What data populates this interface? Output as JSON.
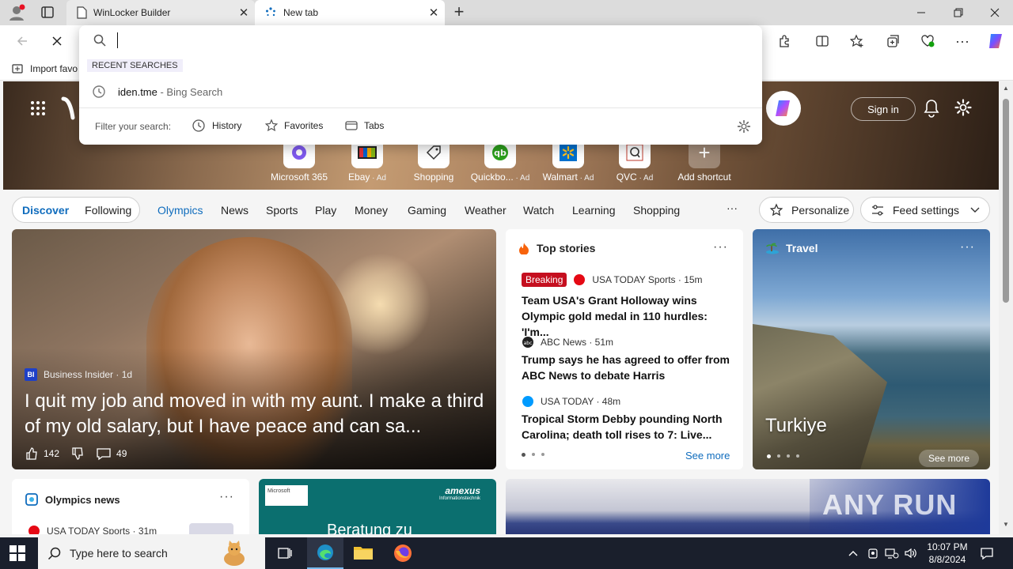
{
  "tabs": [
    {
      "title": "WinLocker Builder"
    },
    {
      "title": "New tab"
    }
  ],
  "favorites_bar": {
    "import_label": "Import favo"
  },
  "omnibox": {
    "recent_heading": "RECENT SEARCHES",
    "recent_item": {
      "query": "iden.tme",
      "suffix": " - Bing Search"
    },
    "filter_label": "Filter your search:",
    "filters": [
      "History",
      "Favorites",
      "Tabs"
    ]
  },
  "hero": {
    "sign_in": "Sign in"
  },
  "shortcuts": [
    {
      "label": "Microsoft 365",
      "ad": ""
    },
    {
      "label": "Ebay",
      "ad": " · Ad"
    },
    {
      "label": "Shopping",
      "ad": ""
    },
    {
      "label": "Quickbo...",
      "ad": " · Ad"
    },
    {
      "label": "Walmart",
      "ad": " · Ad"
    },
    {
      "label": "QVC",
      "ad": " · Ad"
    },
    {
      "label": "Add shortcut",
      "ad": ""
    }
  ],
  "nav": {
    "discover": "Discover",
    "following": "Following",
    "links": [
      "Olympics",
      "News",
      "Sports",
      "Play",
      "Money",
      "Gaming",
      "Weather",
      "Watch",
      "Learning",
      "Shopping"
    ],
    "more": "···",
    "personalize": "Personalize",
    "feed_settings": "Feed settings"
  },
  "main_story": {
    "source_badge": "BI",
    "source": "Business Insider · 1d",
    "headline": "I quit my job and moved in with my aunt. I make a third of my old salary, but I have peace and can sa...",
    "likes": "142",
    "comments": "49"
  },
  "top_stories": {
    "title": "Top stories",
    "breaking": "Breaking",
    "items": [
      {
        "source": "USA TODAY Sports · 15m",
        "headline": "Team USA's Grant Holloway wins Olympic gold medal in 110 hurdles: 'I'm..."
      },
      {
        "source": "ABC News · 51m",
        "headline": "Trump says he has agreed to offer from ABC News to debate Harris"
      },
      {
        "source": "USA TODAY · 48m",
        "headline": "Tropical Storm Debby pounding North Carolina; death toll rises to 7: Live..."
      }
    ],
    "see_more": "See more"
  },
  "travel": {
    "title": "Travel",
    "place": "Turkiye",
    "see_more": "See more"
  },
  "olympics_news": {
    "title": "Olympics news",
    "source": "USA TODAY Sports · 31m"
  },
  "ad_card": {
    "brand": "amexus",
    "brand_sub": "Informationstechnik",
    "tag": "Microsoft",
    "text": "Beratung zu"
  },
  "watermark": "ANY RUN",
  "taskbar": {
    "search_placeholder": "Type here to search",
    "time": "10:07 PM",
    "date": "8/8/2024"
  },
  "colors": {
    "accent": "#0f6cbd",
    "breaking": "#c50f1f",
    "taskbar": "#1a1f2c"
  }
}
